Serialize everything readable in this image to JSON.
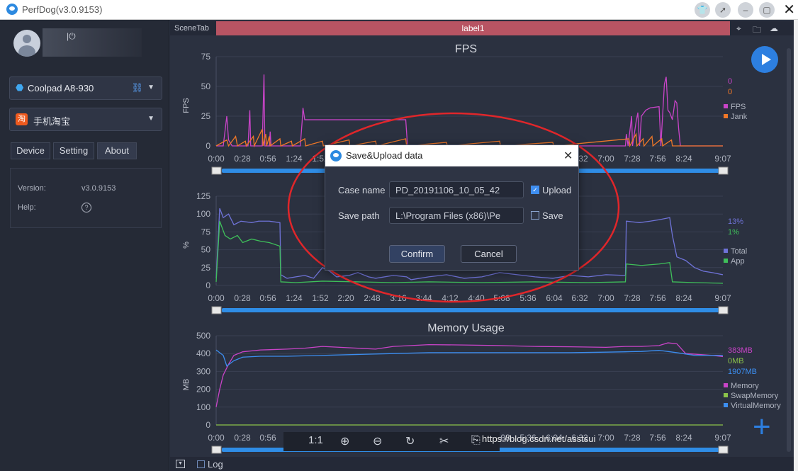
{
  "window": {
    "title": "PerfDog(v3.0.9153)"
  },
  "sidebar": {
    "device": "Coolpad A8-930",
    "app": "手机淘宝",
    "app_icon_char": "淘",
    "tabs": [
      "Device",
      "Setting",
      "About"
    ],
    "active_tab": "About",
    "info": {
      "version_label": "Version:",
      "version_value": "v3.0.9153",
      "help_label": "Help:"
    }
  },
  "main": {
    "scene_tab": "SceneTab",
    "label_tab": "label1",
    "log_label": "Log",
    "zoom_label": "1:1",
    "watermark": "https://blog.csdn.net/asstsui"
  },
  "dialog": {
    "title": "Save&Upload data",
    "case_name_label": "Case name",
    "case_name_value": "PD_20191106_10_05_42",
    "save_path_label": "Save path",
    "save_path_value": "L:\\Program Files (x86)\\Pe",
    "browse_label": "···",
    "upload_label": "Upload",
    "upload_checked": true,
    "save_label": "Save",
    "save_checked": false,
    "confirm_label": "Confirm",
    "cancel_label": "Cancel"
  },
  "chart_data": [
    {
      "type": "line",
      "title": "FPS",
      "ylabel": "FPS",
      "ylim": [
        0,
        75
      ],
      "yticks": [
        0,
        25,
        50,
        75
      ],
      "x": [
        "0:00",
        "0:28",
        "0:56",
        "1:24",
        "1:52",
        "2:20",
        "2:48",
        "3:16",
        "3:44",
        "4:12",
        "4:40",
        "5:08",
        "5:36",
        "6:04",
        "6:32",
        "7:00",
        "7:28",
        "7:56",
        "8:24",
        "9:07"
      ],
      "series": [
        {
          "name": "FPS",
          "color": "#c944c8",
          "current": "0",
          "points": [
            [
              0,
              0
            ],
            [
              8,
              0
            ],
            [
              12,
              25
            ],
            [
              14,
              5
            ],
            [
              18,
              0
            ],
            [
              36,
              0
            ],
            [
              38,
              30
            ],
            [
              39,
              0
            ],
            [
              52,
              0
            ],
            [
              54,
              60
            ],
            [
              55,
              0
            ],
            [
              60,
              0
            ],
            [
              61,
              12
            ],
            [
              62,
              0
            ],
            [
              95,
              0
            ],
            [
              97,
              20
            ],
            [
              98,
              32
            ],
            [
              100,
              22
            ],
            [
              135,
              22
            ],
            [
              170,
              22
            ],
            [
              200,
              22
            ],
            [
              214,
              22
            ],
            [
              216,
              0
            ],
            [
              240,
              0
            ],
            [
              280,
              0
            ],
            [
              300,
              0
            ],
            [
              340,
              0
            ],
            [
              380,
              0
            ],
            [
              430,
              0
            ],
            [
              462,
              0
            ],
            [
              463,
              10
            ],
            [
              465,
              0
            ],
            [
              469,
              25
            ],
            [
              470,
              0
            ],
            [
              474,
              20
            ],
            [
              476,
              28
            ],
            [
              478,
              0
            ],
            [
              480,
              25
            ],
            [
              485,
              30
            ],
            [
              490,
              32
            ],
            [
              500,
              33
            ],
            [
              502,
              0
            ],
            [
              506,
              52
            ],
            [
              508,
              58
            ],
            [
              510,
              30
            ],
            [
              512,
              28
            ],
            [
              515,
              22
            ],
            [
              518,
              38
            ],
            [
              520,
              36
            ],
            [
              522,
              15
            ],
            [
              524,
              0
            ],
            [
              560,
              0
            ],
            [
              572,
              0
            ]
          ]
        },
        {
          "name": "Jank",
          "color": "#f07828",
          "current": "0",
          "points": [
            [
              0,
              0
            ],
            [
              12,
              5
            ],
            [
              14,
              0
            ],
            [
              22,
              8
            ],
            [
              24,
              0
            ],
            [
              33,
              4
            ],
            [
              34,
              0
            ],
            [
              42,
              8
            ],
            [
              43,
              0
            ],
            [
              52,
              14
            ],
            [
              53,
              0
            ],
            [
              56,
              10
            ],
            [
              57,
              0
            ],
            [
              60,
              8
            ],
            [
              61,
              0
            ],
            [
              72,
              6
            ],
            [
              73,
              0
            ],
            [
              85,
              4
            ],
            [
              86,
              0
            ],
            [
              100,
              6
            ],
            [
              101,
              0
            ],
            [
              120,
              4
            ],
            [
              121,
              0
            ],
            [
              150,
              5
            ],
            [
              151,
              0
            ],
            [
              180,
              4
            ],
            [
              181,
              0
            ],
            [
              214,
              6
            ],
            [
              215,
              0
            ],
            [
              260,
              3
            ],
            [
              261,
              0
            ],
            [
              320,
              4
            ],
            [
              321,
              0
            ],
            [
              380,
              3
            ],
            [
              381,
              0
            ],
            [
              466,
              6
            ],
            [
              467,
              0
            ],
            [
              474,
              10
            ],
            [
              475,
              0
            ],
            [
              482,
              6
            ],
            [
              483,
              0
            ],
            [
              492,
              8
            ],
            [
              493,
              0
            ],
            [
              503,
              6
            ],
            [
              504,
              0
            ],
            [
              514,
              5
            ],
            [
              515,
              0
            ],
            [
              572,
              0
            ]
          ]
        }
      ],
      "legend": [
        "FPS",
        "Jank"
      ]
    },
    {
      "type": "line",
      "title": "",
      "ylabel": "%",
      "ylim": [
        0,
        125
      ],
      "yticks": [
        0,
        25,
        50,
        75,
        100,
        125
      ],
      "x": [
        "0:00",
        "0:28",
        "0:56",
        "1:24",
        "1:52",
        "2:20",
        "2:48",
        "3:16",
        "3:44",
        "4:12",
        "4:40",
        "5:08",
        "5:36",
        "6:04",
        "6:32",
        "7:00",
        "7:28",
        "7:56",
        "8:24",
        "9:07"
      ],
      "series": [
        {
          "name": "Total",
          "color": "#6f73d8",
          "current": "13%",
          "points": [
            [
              0,
              10
            ],
            [
              4,
              108
            ],
            [
              8,
              95
            ],
            [
              14,
              100
            ],
            [
              20,
              85
            ],
            [
              28,
              90
            ],
            [
              40,
              88
            ],
            [
              48,
              90
            ],
            [
              60,
              90
            ],
            [
              72,
              88
            ],
            [
              73,
              15
            ],
            [
              80,
              10
            ],
            [
              90,
              12
            ],
            [
              100,
              14
            ],
            [
              110,
              10
            ],
            [
              120,
              25
            ],
            [
              128,
              20
            ],
            [
              136,
              12
            ],
            [
              150,
              14
            ],
            [
              160,
              18
            ],
            [
              172,
              12
            ],
            [
              180,
              10
            ],
            [
              200,
              14
            ],
            [
              215,
              12
            ],
            [
              220,
              8
            ],
            [
              240,
              12
            ],
            [
              260,
              15
            ],
            [
              280,
              10
            ],
            [
              300,
              12
            ],
            [
              320,
              18
            ],
            [
              340,
              15
            ],
            [
              360,
              12
            ],
            [
              380,
              10
            ],
            [
              400,
              14
            ],
            [
              420,
              12
            ],
            [
              440,
              15
            ],
            [
              462,
              14
            ],
            [
              463,
              90
            ],
            [
              478,
              88
            ],
            [
              490,
              90
            ],
            [
              500,
              92
            ],
            [
              512,
              95
            ],
            [
              515,
              70
            ],
            [
              520,
              40
            ],
            [
              530,
              35
            ],
            [
              540,
              25
            ],
            [
              550,
              20
            ],
            [
              560,
              18
            ],
            [
              572,
              15
            ]
          ]
        },
        {
          "name": "App",
          "color": "#3fbf5a",
          "current": "1%",
          "points": [
            [
              0,
              5
            ],
            [
              4,
              90
            ],
            [
              10,
              70
            ],
            [
              16,
              65
            ],
            [
              24,
              70
            ],
            [
              30,
              60
            ],
            [
              40,
              65
            ],
            [
              50,
              62
            ],
            [
              60,
              60
            ],
            [
              72,
              55
            ],
            [
              73,
              5
            ],
            [
              90,
              4
            ],
            [
              120,
              6
            ],
            [
              160,
              5
            ],
            [
              200,
              4
            ],
            [
              240,
              5
            ],
            [
              300,
              4
            ],
            [
              360,
              5
            ],
            [
              420,
              4
            ],
            [
              462,
              5
            ],
            [
              463,
              30
            ],
            [
              480,
              28
            ],
            [
              500,
              30
            ],
            [
              512,
              32
            ],
            [
              515,
              5
            ],
            [
              540,
              4
            ],
            [
              572,
              3
            ]
          ]
        }
      ],
      "legend": [
        "Total",
        "App"
      ]
    },
    {
      "type": "line",
      "title": "Memory Usage",
      "ylabel": "MB",
      "ylim": [
        0,
        500
      ],
      "yticks": [
        0,
        100,
        200,
        300,
        400,
        500
      ],
      "x": [
        "0:00",
        "0:28",
        "0:56",
        "1:24",
        "1:52",
        "2:20",
        "2:48",
        "3:16",
        "3:44",
        "4:12",
        "4:40",
        "5:08",
        "5:36",
        "6:04",
        "6:32",
        "7:00",
        "7:28",
        "7:56",
        "8:24",
        "9:07"
      ],
      "series": [
        {
          "name": "Memory",
          "color": "#c944c8",
          "current": "383MB",
          "points": [
            [
              0,
              100
            ],
            [
              4,
              200
            ],
            [
              8,
              280
            ],
            [
              14,
              340
            ],
            [
              20,
              390
            ],
            [
              30,
              410
            ],
            [
              50,
              420
            ],
            [
              80,
              425
            ],
            [
              100,
              430
            ],
            [
              120,
              440
            ],
            [
              140,
              435
            ],
            [
              160,
              430
            ],
            [
              180,
              425
            ],
            [
              200,
              440
            ],
            [
              220,
              445
            ],
            [
              240,
              450
            ],
            [
              280,
              448
            ],
            [
              320,
              445
            ],
            [
              360,
              440
            ],
            [
              400,
              438
            ],
            [
              440,
              435
            ],
            [
              462,
              440
            ],
            [
              480,
              440
            ],
            [
              500,
              445
            ],
            [
              510,
              460
            ],
            [
              520,
              455
            ],
            [
              530,
              400
            ],
            [
              560,
              390
            ],
            [
              572,
              383
            ]
          ]
        },
        {
          "name": "SwapMemory",
          "color": "#8bc34a",
          "current": "0MB",
          "points": [
            [
              0,
              0
            ],
            [
              572,
              0
            ]
          ]
        },
        {
          "name": "VirtualMemory",
          "color": "#3c8ef0",
          "current": "1907MB",
          "points": [
            [
              0,
              420
            ],
            [
              8,
              390
            ],
            [
              12,
              330
            ],
            [
              20,
              360
            ],
            [
              30,
              380
            ],
            [
              50,
              385
            ],
            [
              80,
              385
            ],
            [
              120,
              390
            ],
            [
              160,
              395
            ],
            [
              200,
              400
            ],
            [
              240,
              405
            ],
            [
              280,
              405
            ],
            [
              320,
              405
            ],
            [
              360,
              405
            ],
            [
              400,
              405
            ],
            [
              440,
              408
            ],
            [
              462,
              410
            ],
            [
              480,
              412
            ],
            [
              500,
              418
            ],
            [
              520,
              405
            ],
            [
              540,
              390
            ],
            [
              572,
              390
            ]
          ]
        }
      ],
      "legend": [
        "Memory",
        "SwapMemory",
        "VirtualMemory"
      ]
    }
  ]
}
